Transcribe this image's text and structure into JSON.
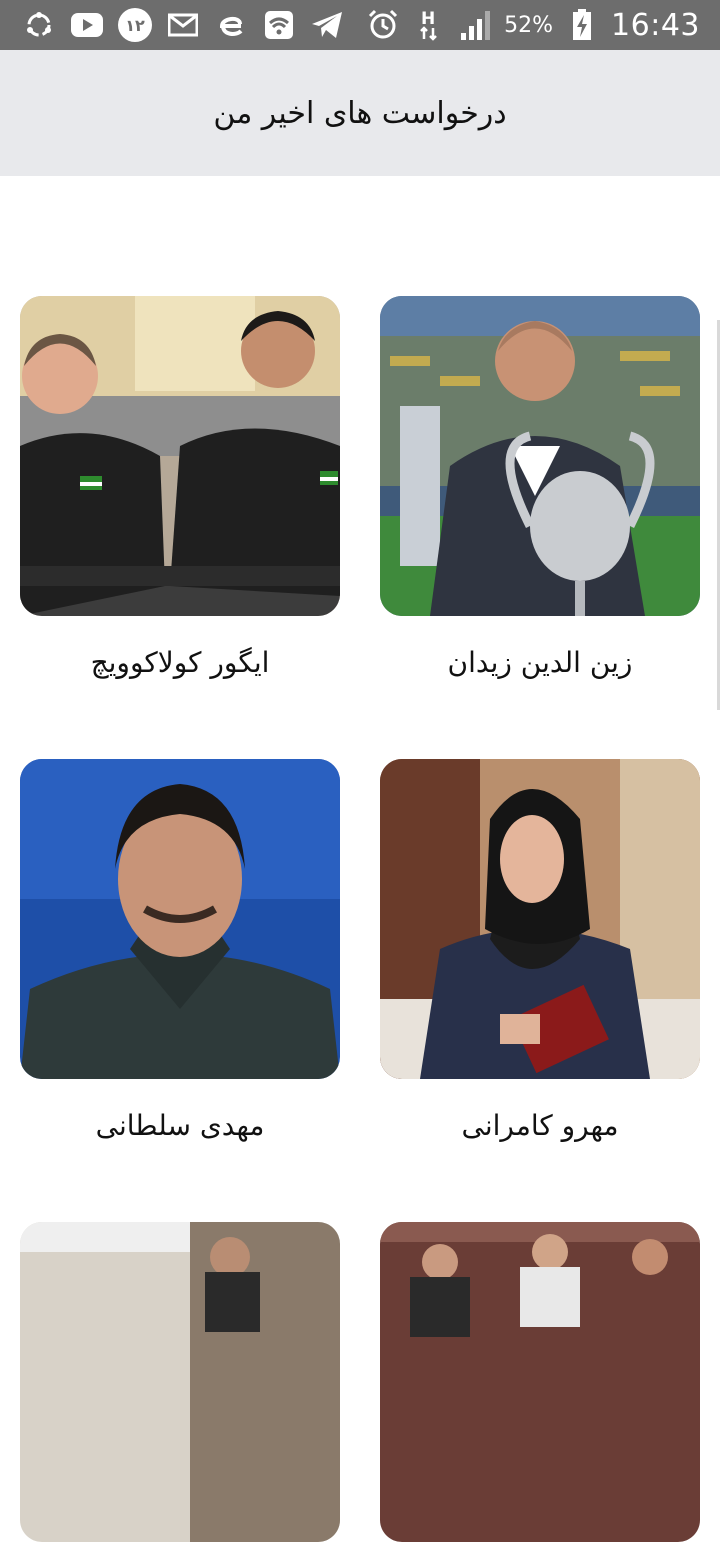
{
  "status_bar": {
    "notification_badge": "١٢",
    "battery": "52%",
    "time": "16:43",
    "network": "H"
  },
  "header": {
    "title": "درخواست های اخیر من"
  },
  "people": [
    {
      "name": "زین الدین زیدان",
      "photo": "photo-zidane"
    },
    {
      "name": "ایگور کولاکوویچ",
      "photo": "photo-kolakovic"
    },
    {
      "name": "مهرو کامرانی",
      "photo": "photo-kamrani"
    },
    {
      "name": "مهدی سلطانی",
      "photo": "photo-soltani"
    },
    {
      "name": "",
      "photo": "photo-5"
    },
    {
      "name": "",
      "photo": "photo-6"
    }
  ]
}
